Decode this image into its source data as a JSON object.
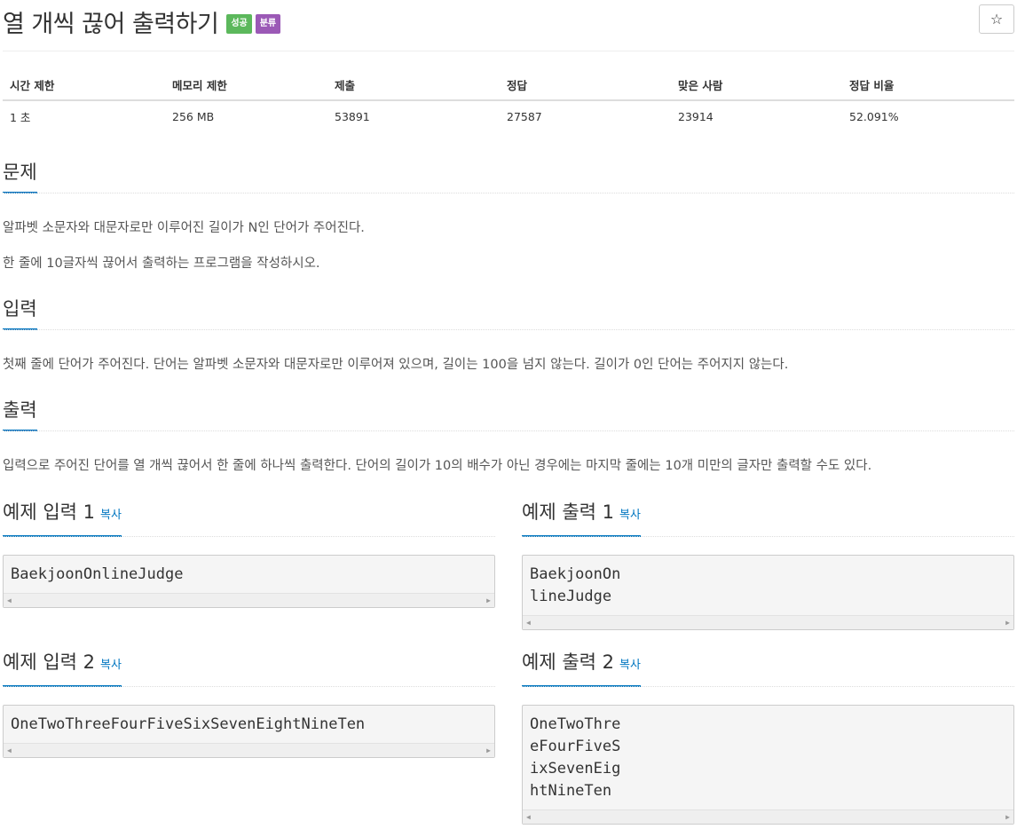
{
  "problem": {
    "title": "열 개씩 끊어 출력하기",
    "badges": {
      "success": "성공",
      "class": "분류"
    },
    "star_icon": "☆"
  },
  "stats": {
    "headers": [
      "시간 제한",
      "메모리 제한",
      "제출",
      "정답",
      "맞은 사람",
      "정답 비율"
    ],
    "values": [
      "1 초",
      "256 MB",
      "53891",
      "27587",
      "23914",
      "52.091%"
    ]
  },
  "sections": {
    "description": {
      "title": "문제",
      "lines": [
        "알파벳 소문자와 대문자로만 이루어진 길이가 N인 단어가 주어진다.",
        "한 줄에 10글자씩 끊어서 출력하는 프로그램을 작성하시오."
      ]
    },
    "input": {
      "title": "입력",
      "text": "첫째 줄에 단어가 주어진다. 단어는 알파벳 소문자와 대문자로만 이루어져 있으며, 길이는 100을 넘지 않는다. 길이가 0인 단어는 주어지지 않는다."
    },
    "output": {
      "title": "출력",
      "text": "입력으로 주어진 단어를 열 개씩 끊어서 한 줄에 하나씩 출력한다. 단어의 길이가 10의 배수가 아닌 경우에는 마지막 줄에는 10개 미만의 글자만 출력할 수도 있다."
    }
  },
  "samples": {
    "copy_label": "복사",
    "input1": {
      "title": "예제 입력 1",
      "content": "BaekjoonOnlineJudge"
    },
    "output1": {
      "title": "예제 출력 1",
      "content": "BaekjoonOn\nlineJudge"
    },
    "input2": {
      "title": "예제 입력 2",
      "content": "OneTwoThreeFourFiveSixSevenEightNineTen"
    },
    "output2": {
      "title": "예제 출력 2",
      "content": "OneTwoThre\neFourFiveS\nixSevenEig\nhtNineTen"
    }
  }
}
